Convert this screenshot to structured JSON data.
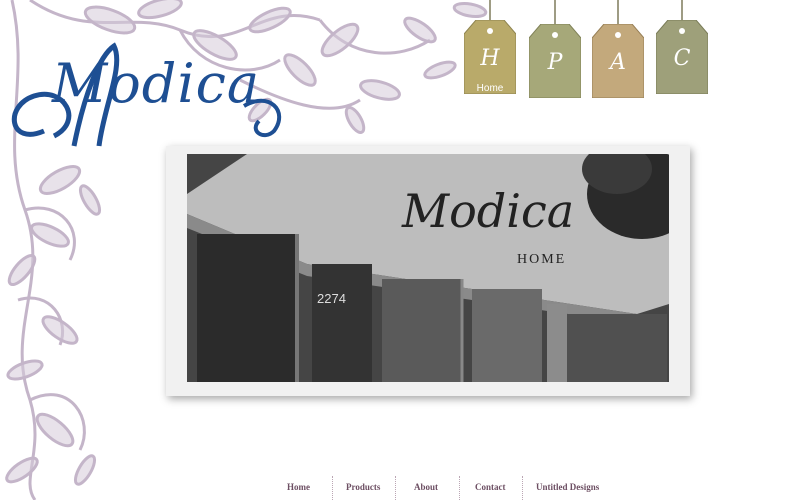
{
  "brand": {
    "logo_text": "Modica"
  },
  "tags": [
    {
      "letter": "H",
      "caption": "Home",
      "color": "#b9aa6a"
    },
    {
      "letter": "P",
      "caption": "",
      "color": "#a6a879"
    },
    {
      "letter": "A",
      "caption": "",
      "color": "#c3a97c"
    },
    {
      "letter": "C",
      "caption": "",
      "color": "#9ea07a"
    }
  ],
  "photo": {
    "sign_text": "Modica",
    "sign_subtext": "HOME",
    "address": "2274"
  },
  "nav": {
    "items": [
      "Home",
      "Products",
      "About",
      "Contact",
      "Untitled Designs"
    ]
  },
  "colors": {
    "logo": "#1e4f93",
    "floral": "#c9bccd",
    "nav": "#6d4f63"
  }
}
